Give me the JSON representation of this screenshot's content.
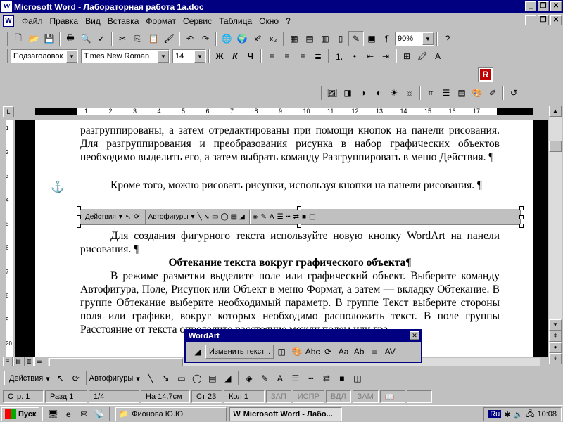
{
  "window": {
    "title": "Microsoft Word - Лабораторная работа 1а.doc"
  },
  "menu": [
    "Файл",
    "Правка",
    "Вид",
    "Вставка",
    "Формат",
    "Сервис",
    "Таблица",
    "Окно",
    "?"
  ],
  "standard_toolbar": {
    "zoom": "90%"
  },
  "formatting_toolbar": {
    "style": "Подзаголовок",
    "font": "Times New Roman",
    "size": "14",
    "bold": "Ж",
    "italic": "К",
    "underline": "Ч"
  },
  "ruler": {
    "numbers": [
      "1",
      "2",
      "3",
      "4",
      "5",
      "6",
      "7",
      "8",
      "9",
      "10",
      "11",
      "12",
      "13",
      "14",
      "15",
      "16",
      "17"
    ]
  },
  "vruler": {
    "numbers": [
      "1",
      "2",
      "3",
      "4",
      "5",
      "6",
      "7",
      "8",
      "9",
      "20"
    ]
  },
  "document": {
    "p1": "разгруппированы, а затем отредактированы при помощи кнопок на панели рисования. Для разгруппирования и преобразования рисунка в набор графических объектов необходимо выделить его, а затем выбрать команду Разгруппировать в меню Действия. ¶",
    "p2": "Кроме того, можно рисовать рисунки, используя кнопки на панели рисования. ¶",
    "p3": "Для создания фигурного текста используйте новую кнопку WordArt на панели рисования. ¶",
    "heading": "Обтекание текста вокруг графического объекта¶",
    "p4": "В режиме разметки выделите поле или графический объект. Выберите команду Автофигура, Поле, Рисунок или Объект в меню Формат, а затем — вкладку Обтекание. В группе Обтекание выберите необходимый параметр. В группе Текст выберите стороны поля или графики, вокруг которых необходимо расположить текст. В поле группы Расстояние от текста определите расстояние между полем или гра"
  },
  "inner_draw_toolbar": {
    "actions": "Действия",
    "autoshapes": "Автофигуры"
  },
  "wordart_toolbar": {
    "title": "WordArt",
    "edit_text": "Изменить текст..."
  },
  "drawing_toolbar": {
    "actions": "Действия",
    "autoshapes": "Автофигуры"
  },
  "status": {
    "page": "Стр. 1",
    "section": "Разд 1",
    "pages": "1/4",
    "at": "На 14,7см",
    "line": "Ст 23",
    "col": "Кол 1",
    "rec": "ЗАП",
    "trk": "ИСПР",
    "ext": "ВДЛ",
    "ovr": "ЗАМ"
  },
  "taskbar": {
    "start": "Пуск",
    "task1": "Фионова Ю.Ю",
    "task2": "Microsoft Word - Лабо...",
    "lang": "Ru",
    "clock": "10:08"
  },
  "colors": {
    "titlebar": "#000080",
    "face": "#c0c0c0",
    "logo_red": "#c00000"
  }
}
